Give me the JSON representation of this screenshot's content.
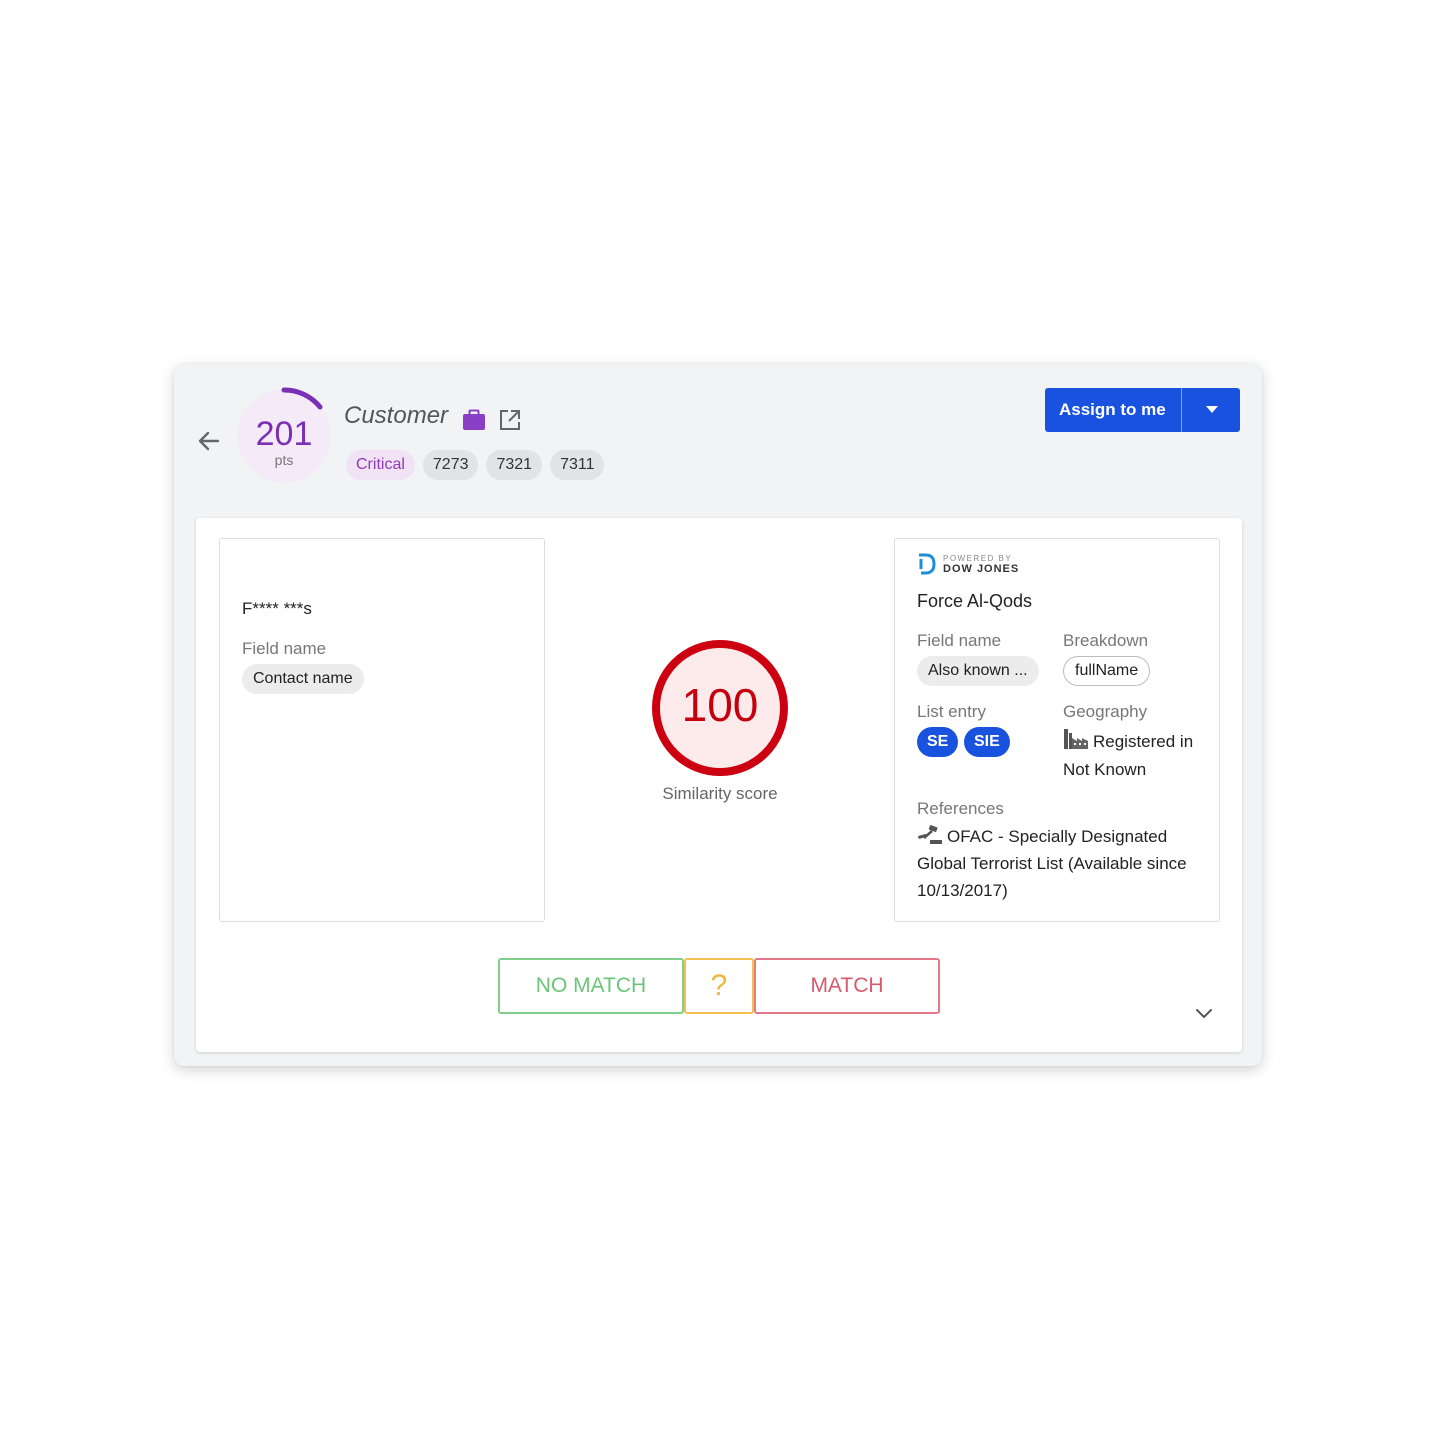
{
  "header": {
    "score": "201",
    "score_unit": "pts",
    "score_progress": 0.12,
    "entity_type": "Customer",
    "tags": [
      "Critical",
      "7273",
      "7321",
      "7311"
    ],
    "assign_label": "Assign to me",
    "accent_color": "#7b2fb5",
    "primary_color": "#1a52e0"
  },
  "customer_panel": {
    "masked_name": "F**** ***s",
    "field_name_label": "Field name",
    "field_name_value": "Contact name"
  },
  "similarity": {
    "value": "100",
    "label": "Similarity score",
    "color": "#cc0011"
  },
  "match_panel": {
    "powered_by": "POWERED BY",
    "provider": "DOW JONES",
    "title": "Force Al-Qods",
    "field_name_label": "Field name",
    "field_name_value": "Also known ...",
    "breakdown_label": "Breakdown",
    "breakdown_value": "fullName",
    "list_entry_label": "List entry",
    "list_entries": [
      "SE",
      "SIE"
    ],
    "geography_label": "Geography",
    "geography_value": "Registered in Not Known",
    "references_label": "References",
    "references_value": "OFAC - Specially Designated Global Terrorist List (Available since 10/13/2017)"
  },
  "decision": {
    "no_match": "NO MATCH",
    "unsure": "?",
    "match": "MATCH"
  },
  "icons": {
    "back": "arrow-left-icon",
    "briefcase": "briefcase-icon",
    "external": "external-link-icon",
    "caret": "caret-down-icon",
    "factory": "factory-icon",
    "gavel": "gavel-icon",
    "chevron": "chevron-down-icon"
  }
}
